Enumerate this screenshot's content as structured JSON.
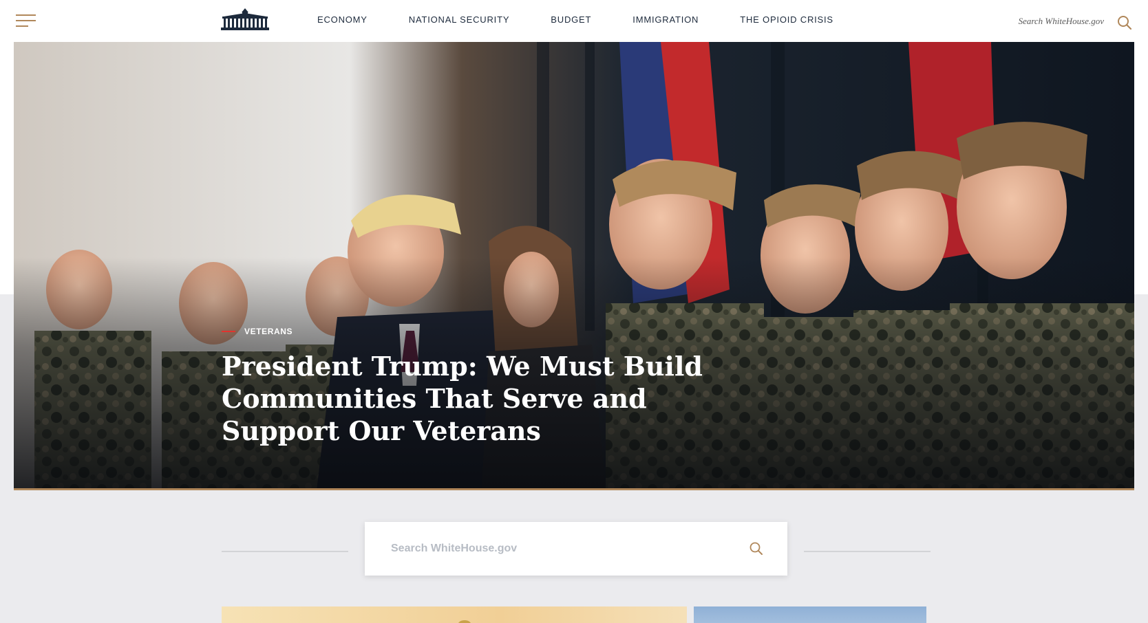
{
  "header": {
    "menu_icon": "hamburger-icon",
    "logo_icon": "white-house-logo",
    "nav": [
      {
        "label": "ECONOMY"
      },
      {
        "label": "NATIONAL SECURITY"
      },
      {
        "label": "BUDGET"
      },
      {
        "label": "IMMIGRATION"
      },
      {
        "label": "THE OPIOID CRISIS"
      }
    ],
    "search_placeholder": "Search WhiteHouse.gov",
    "search_icon": "search-icon"
  },
  "hero": {
    "category": "VETERANS",
    "title": "President Trump: We Must Build Communities That Serve and Support Our Veterans",
    "accent_color": "#e3332e"
  },
  "main_search": {
    "placeholder": "Search WhiteHouse.gov",
    "icon": "search-icon"
  },
  "colors": {
    "gold": "#b0875a",
    "navy": "#1d2a3c",
    "page_gray": "#ebebee"
  }
}
